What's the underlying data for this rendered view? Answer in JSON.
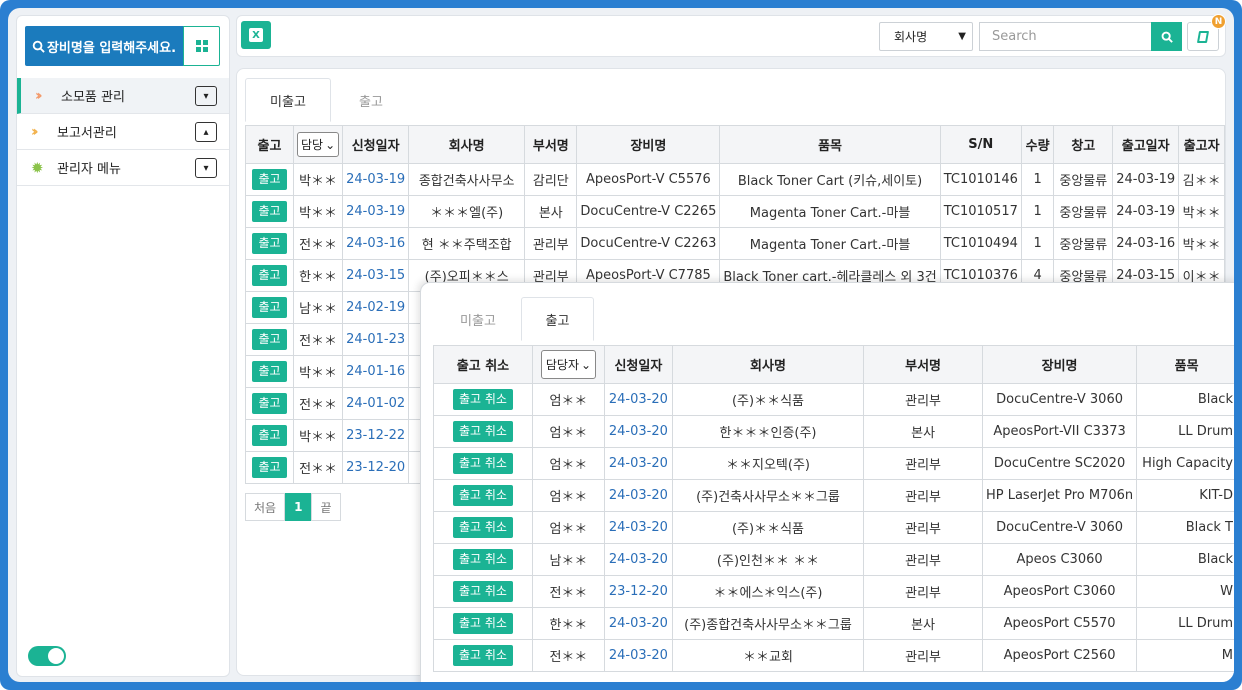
{
  "sidebar": {
    "search_label": "장비명을 입력해주세요.",
    "menu": [
      {
        "label": "소모품 관리",
        "icon": "double-chevron-right-icon",
        "toggle": "▾"
      },
      {
        "label": "보고서관리",
        "icon": "double-chevron-right-icon",
        "toggle": "▴"
      },
      {
        "label": "관리자 메뉴",
        "icon": "gear-icon",
        "toggle": "▾"
      }
    ]
  },
  "topbar": {
    "company_select": "회사명",
    "search_placeholder": "Search",
    "badge": "N"
  },
  "main": {
    "tabs": [
      "미출고",
      "출고"
    ],
    "headers": [
      "출고",
      "담당",
      "신청일자",
      "회사명",
      "부서명",
      "장비명",
      "품목",
      "S/N",
      "수량",
      "창고",
      "출고일자",
      "출고자"
    ],
    "button_label": "출고",
    "rows": [
      [
        "박＊＊",
        "24-03-19",
        "종합건축사사무소",
        "감리단",
        "ApeosPort-V C5576",
        "Black Toner Cart (키슈,세이토)",
        "TC1010146",
        "1",
        "중앙물류",
        "24-03-19",
        "김＊＊"
      ],
      [
        "박＊＊",
        "24-03-19",
        "＊＊＊엘(주)",
        "본사",
        "DocuCentre-V C2265",
        "Magenta Toner Cart.-마블",
        "TC1010517",
        "1",
        "중앙물류",
        "24-03-19",
        "박＊＊"
      ],
      [
        "전＊＊",
        "24-03-16",
        "현 ＊＊주택조합",
        "관리부",
        "DocuCentre-V C2263",
        "Magenta Toner Cart.-마블",
        "TC1010494",
        "1",
        "중앙물류",
        "24-03-16",
        "박＊＊"
      ],
      [
        "한＊＊",
        "24-03-15",
        "(주)오피＊＊스",
        "관리부",
        "ApeosPort-V C7785",
        "Black Toner cart.-헤라클레스 외 3건",
        "TC1010376",
        "4",
        "중앙물류",
        "24-03-15",
        "이＊＊"
      ],
      [
        "남＊＊",
        "24-02-19",
        "",
        "",
        "",
        "",
        "",
        "",
        "",
        "",
        ""
      ],
      [
        "전＊＊",
        "24-01-23",
        "",
        "",
        "",
        "",
        "",
        "",
        "",
        "",
        ""
      ],
      [
        "박＊＊",
        "24-01-16",
        "",
        "",
        "",
        "",
        "",
        "",
        "",
        "",
        ""
      ],
      [
        "전＊＊",
        "24-01-02",
        "",
        "",
        "",
        "",
        "",
        "",
        "",
        "",
        ""
      ],
      [
        "박＊＊",
        "23-12-22",
        "",
        "",
        "",
        "",
        "",
        "",
        "",
        "",
        ""
      ],
      [
        "전＊＊",
        "23-12-20",
        "",
        "",
        "",
        "",
        "",
        "",
        "",
        "",
        ""
      ]
    ],
    "pager": {
      "first": "처음",
      "current": "1",
      "last": "끝"
    }
  },
  "overlay": {
    "tabs": [
      "미출고",
      "출고"
    ],
    "headers": [
      "출고 취소",
      "담당자",
      "신청일자",
      "회사명",
      "부서명",
      "장비명",
      "품목"
    ],
    "button_label": "출고 취소",
    "rows": [
      [
        "엄＊＊",
        "24-03-20",
        "(주)＊＊식품",
        "관리부",
        "DocuCentre-V 3060",
        "Black"
      ],
      [
        "엄＊＊",
        "24-03-20",
        "한＊＊＊인증(주)",
        "본사",
        "ApeosPort-VII C3373",
        "LL Drum"
      ],
      [
        "엄＊＊",
        "24-03-20",
        "＊＊지오텍(주)",
        "관리부",
        "DocuCentre SC2020",
        "High Capacity"
      ],
      [
        "엄＊＊",
        "24-03-20",
        "(주)건축사사무소＊＊그룹",
        "관리부",
        "HP LaserJet Pro M706n",
        "KIT-D"
      ],
      [
        "엄＊＊",
        "24-03-20",
        "(주)＊＊식품",
        "관리부",
        "DocuCentre-V 3060",
        "Black T"
      ],
      [
        "남＊＊",
        "24-03-20",
        "(주)인천＊＊ ＊＊",
        "관리부",
        "Apeos C3060",
        "Black"
      ],
      [
        "전＊＊",
        "23-12-20",
        "＊＊에스＊익스(주)",
        "관리부",
        "ApeosPort C3060",
        "W"
      ],
      [
        "한＊＊",
        "24-03-20",
        "(주)종합건축사사무소＊＊그룹",
        "본사",
        "ApeosPort C5570",
        "LL Drum"
      ],
      [
        "전＊＊",
        "24-03-20",
        "＊＊교회",
        "관리부",
        "ApeosPort C2560",
        "M"
      ]
    ]
  }
}
